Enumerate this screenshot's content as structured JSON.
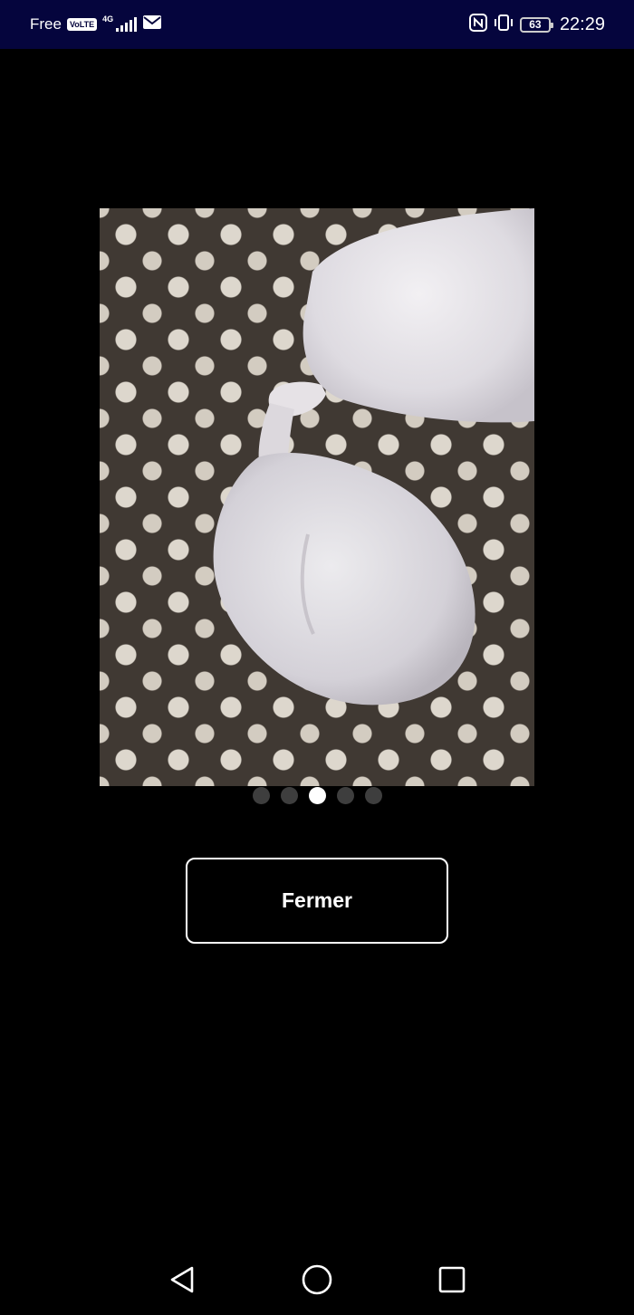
{
  "status_bar": {
    "carrier": "Free",
    "volte_badge": "VoLTE",
    "network_type": "4G",
    "icons": [
      "signal-icon",
      "mail-icon",
      "nfc-icon",
      "vibrate-icon",
      "battery-icon"
    ],
    "battery_level": "63",
    "time": "22:29"
  },
  "viewer": {
    "photo_icon": "photo-image",
    "page_count": 5,
    "current_page": 3
  },
  "close_button": {
    "label": "Fermer"
  },
  "nav_bar": {
    "icons": [
      "back-triangle-icon",
      "home-circle-icon",
      "recents-square-icon"
    ]
  },
  "colors": {
    "status_bar_bg": "#05053d",
    "background": "#000000",
    "dot_active": "#ffffff",
    "dot_inactive": "#3e3e3e"
  }
}
